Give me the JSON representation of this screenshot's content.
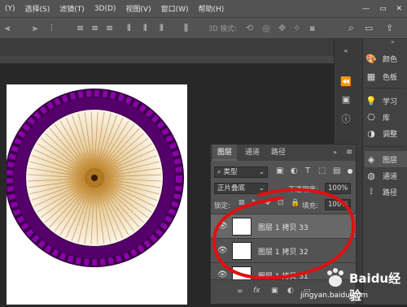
{
  "menu": [
    "(Y)",
    "选择(S)",
    "滤镜(T)",
    "3D(D)",
    "视图(V)",
    "窗口(W)",
    "帮助(H)"
  ],
  "options_bar": {
    "mode_label": "3D 模式:"
  },
  "dock": {
    "items": [
      "颜色",
      "色板",
      "学习",
      "库",
      "调整",
      "图层",
      "通道",
      "路径"
    ]
  },
  "layers_panel": {
    "tabs": [
      "图层",
      "通道",
      "路径"
    ],
    "filter_kind": "类型",
    "blend_mode": "正片叠底",
    "opacity_label": "不透明度:",
    "opacity_value": "100%",
    "lock_label": "锁定:",
    "fill_label": "填充:",
    "fill_value": "100%",
    "layers": [
      "图层 1 拷贝 33",
      "图层 1 拷贝 32",
      "图层 1 拷贝 31"
    ],
    "footer_icons": [
      "link-icon",
      "fx-icon",
      "mask-icon",
      "adjustment-icon",
      "group-icon"
    ]
  },
  "watermark": {
    "brand": "Baidu经验",
    "url": "jingyan.baidu.com"
  },
  "colors": {
    "accent_red": "#e01010",
    "wheel_purple": "#6a0080",
    "spoke_tan": "#c9a36a"
  }
}
